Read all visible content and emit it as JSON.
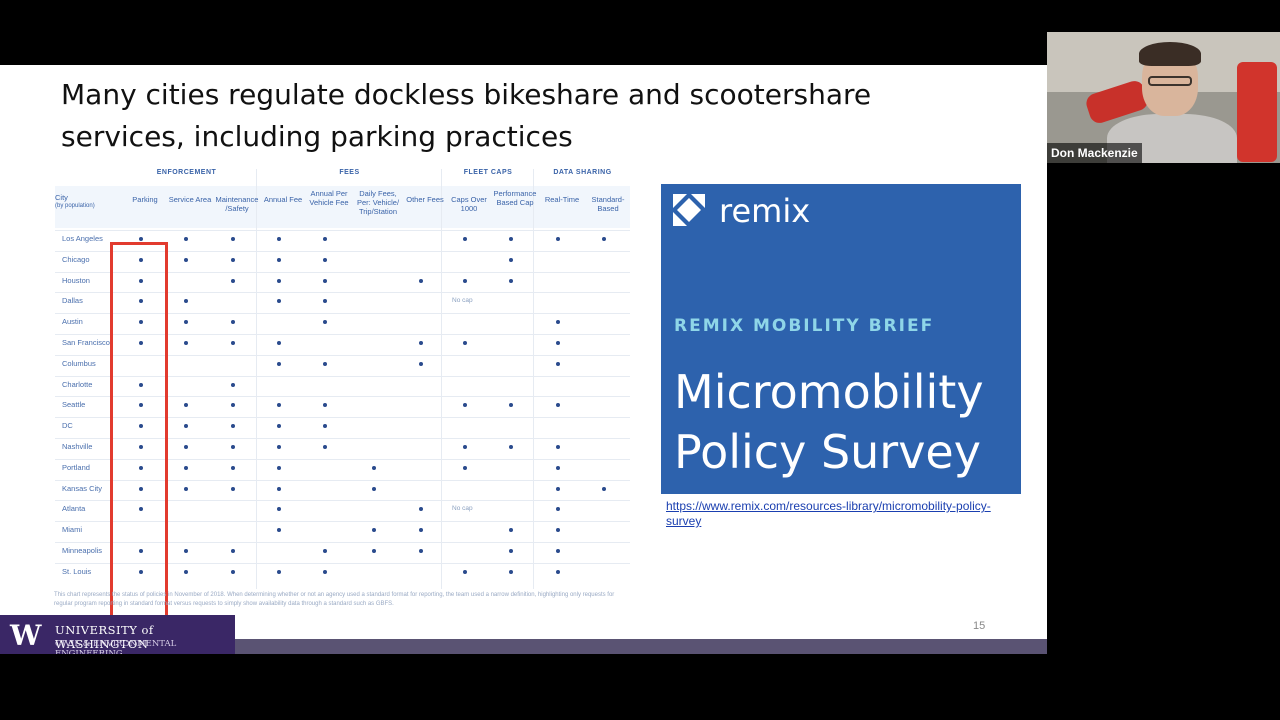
{
  "slide": {
    "title_line1": "Many cities regulate dockless bikeshare and scootershare",
    "title_line2": "services, including parking practices",
    "page_number": "15"
  },
  "table": {
    "groups": [
      "ENFORCEMENT",
      "FEES",
      "FLEET CAPS",
      "DATA SHARING"
    ],
    "city_header": "City",
    "city_subheader": "(by population)",
    "columns": [
      "Parking",
      "Service Area",
      "Maintenance /Safety",
      "Annual Fee",
      "Annual Per Vehicle Fee",
      "Daily Fees, Per: Vehicle/ Trip/Station",
      "Other Fees",
      "Caps Over 1000",
      "Performance Based Cap",
      "Real-Time",
      "Standard-Based"
    ],
    "rows": [
      {
        "city": "Los Angeles",
        "marks": [
          1,
          1,
          1,
          1,
          1,
          0,
          0,
          1,
          1,
          1,
          1
        ]
      },
      {
        "city": "Chicago",
        "marks": [
          1,
          1,
          1,
          1,
          1,
          0,
          0,
          0,
          1,
          0,
          0
        ]
      },
      {
        "city": "Houston",
        "marks": [
          1,
          0,
          1,
          1,
          1,
          0,
          1,
          1,
          1,
          0,
          0
        ]
      },
      {
        "city": "Dallas",
        "marks": [
          1,
          1,
          0,
          1,
          1,
          0,
          0,
          0,
          0,
          0,
          0
        ],
        "note": "No cap"
      },
      {
        "city": "Austin",
        "marks": [
          1,
          1,
          1,
          0,
          1,
          0,
          0,
          0,
          0,
          1,
          0
        ]
      },
      {
        "city": "San Francisco",
        "marks": [
          1,
          1,
          1,
          1,
          0,
          0,
          1,
          1,
          0,
          1,
          0
        ]
      },
      {
        "city": "Columbus",
        "marks": [
          0,
          0,
          0,
          1,
          1,
          0,
          1,
          0,
          0,
          1,
          0
        ]
      },
      {
        "city": "Charlotte",
        "marks": [
          1,
          0,
          1,
          0,
          0,
          0,
          0,
          0,
          0,
          0,
          0
        ]
      },
      {
        "city": "Seattle",
        "marks": [
          1,
          1,
          1,
          1,
          1,
          0,
          0,
          1,
          1,
          1,
          0
        ]
      },
      {
        "city": "DC",
        "marks": [
          1,
          1,
          1,
          1,
          1,
          0,
          0,
          0,
          0,
          0,
          0
        ]
      },
      {
        "city": "Nashville",
        "marks": [
          1,
          1,
          1,
          1,
          1,
          0,
          0,
          1,
          1,
          1,
          0
        ]
      },
      {
        "city": "Portland",
        "marks": [
          1,
          1,
          1,
          1,
          0,
          1,
          0,
          1,
          0,
          1,
          0
        ]
      },
      {
        "city": "Kansas City",
        "marks": [
          1,
          1,
          1,
          1,
          0,
          1,
          0,
          0,
          0,
          1,
          1
        ]
      },
      {
        "city": "Atlanta",
        "marks": [
          1,
          0,
          0,
          1,
          0,
          0,
          1,
          0,
          0,
          1,
          0
        ],
        "note": "No cap"
      },
      {
        "city": "Miami",
        "marks": [
          0,
          0,
          0,
          1,
          0,
          1,
          1,
          0,
          1,
          1,
          0
        ]
      },
      {
        "city": "Minneapolis",
        "marks": [
          1,
          1,
          1,
          0,
          1,
          1,
          1,
          0,
          1,
          1,
          0
        ]
      },
      {
        "city": "St. Louis",
        "marks": [
          1,
          1,
          1,
          1,
          1,
          0,
          0,
          1,
          1,
          1,
          0
        ]
      }
    ],
    "footnote": "This chart represents the status of policies in November of 2018. When determining whether or not an agency used a standard format for reporting, the team used a narrow definition, highlighting only requests for regular program reporting in standard format versus requests to simply show availability data through a standard such as GBFS."
  },
  "brief": {
    "brand": "remix",
    "kicker": "REMIX MOBILITY BRIEF",
    "title_line1": "Micromobility",
    "title_line2": "Policy Survey",
    "link_text": "https://www.remix.com/resources-library/micromobility-policy-survey",
    "bg_color": "#2d62ad"
  },
  "footer": {
    "logo_letter": "W",
    "university": "UNIVERSITY of WASHINGTON",
    "department": "CIVIL & ENVIRONMENTAL ENGINEERING"
  },
  "video": {
    "participant_name": "Don Mackenzie"
  }
}
